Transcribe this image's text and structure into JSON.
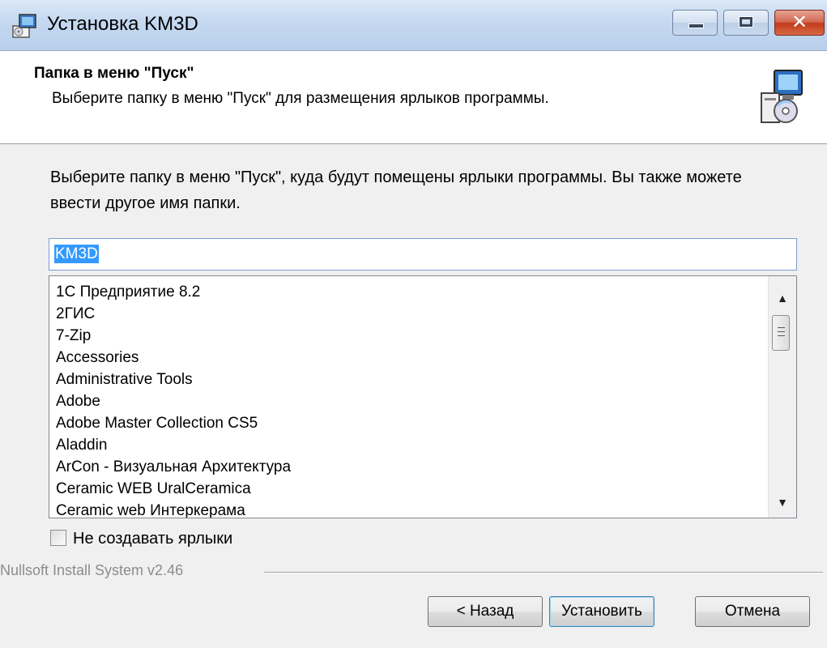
{
  "window": {
    "title": "Установка KM3D",
    "icon": "installer-icon"
  },
  "header": {
    "title": "Папка в меню \"Пуск\"",
    "subtitle": "Выберите папку в меню \"Пуск\" для размещения ярлыков программы.",
    "icon": "setup-computer-cd-icon"
  },
  "body": {
    "description": "Выберите папку в меню \"Пуск\", куда будут помещены ярлыки программы. Вы также можете ввести другое имя папки.",
    "folder_input_value": "KM3D",
    "folders": [
      "1C Предприятие 8.2",
      "2ГИС",
      "7-Zip",
      "Accessories",
      "Administrative Tools",
      "Adobe",
      "Adobe Master Collection CS5",
      "Aladdin",
      "ArCon - Визуальная Архитектура",
      "Ceramic WEB UralCeramica",
      "Ceramic web Интеркерама"
    ],
    "no_shortcuts_label": "Не создавать ярлыки",
    "no_shortcuts_checked": false
  },
  "footer": {
    "branding": "Nullsoft Install System v2.46",
    "back_label": "< Назад",
    "install_label": "Установить",
    "cancel_label": "Отмена"
  }
}
